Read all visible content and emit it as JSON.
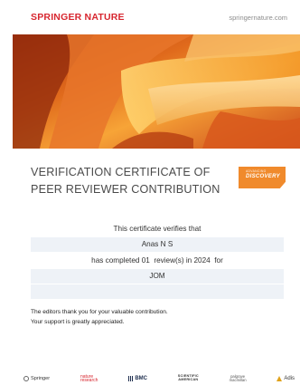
{
  "header": {
    "brand": "SPRINGER NATURE",
    "site": "springernature.com"
  },
  "badge": {
    "top": "ADVANCING",
    "main": "DISCOVERY"
  },
  "certificate": {
    "title_line1": "VERIFICATION CERTIFICATE OF",
    "title_line2": "PEER REVIEWER CONTRIBUTION",
    "intro": "This certificate verifies that",
    "name": "Anas N S",
    "completed_prefix": "has completed ",
    "review_count": "01",
    "review_suffix": "  review(s) in ",
    "year": "2024",
    "for_label": "  for",
    "journal": "JOM"
  },
  "thanks": {
    "line1": "The editors thank you for your valuable contribution.",
    "line2": "Your support is greatly appreciated."
  },
  "footer_logos": {
    "springer": "Springer",
    "nature_line1": "nature",
    "nature_line2": "research",
    "bmc": "BMC",
    "sciam_line1": "SCIENTIFIC",
    "sciam_line2": "AMERICAN",
    "palgrave_line1": "palgrave",
    "palgrave_line2": "macmillan",
    "adis": "Adis"
  },
  "colors": {
    "brand_red": "#d7262f",
    "badge_orange": "#f08a2c",
    "row_shade": "#eef2f7"
  }
}
